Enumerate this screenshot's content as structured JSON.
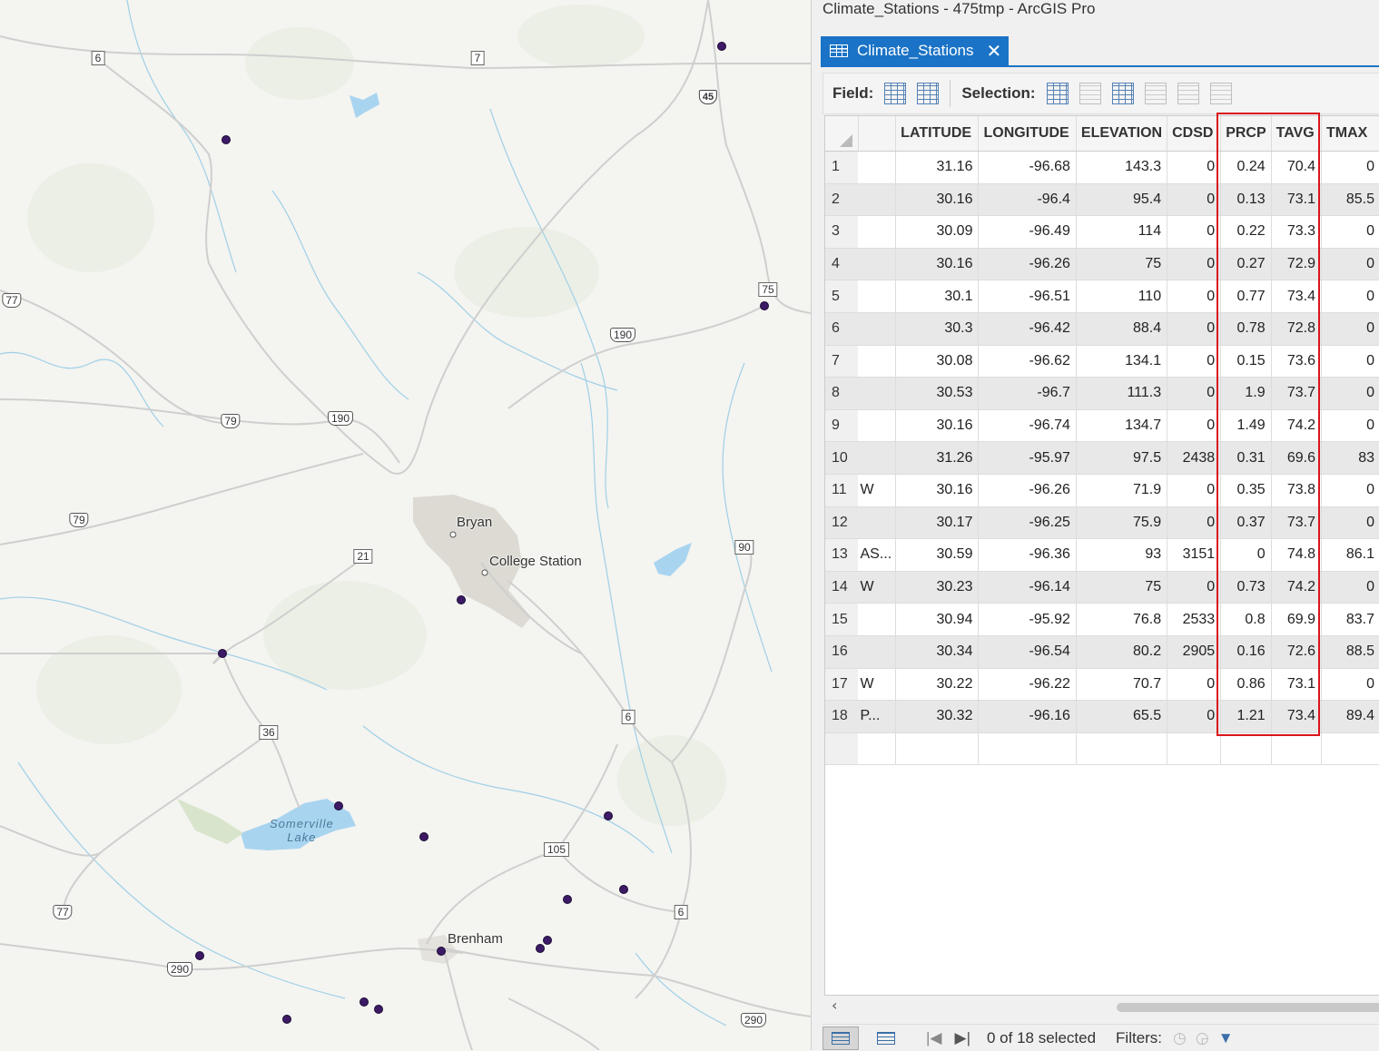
{
  "window": {
    "title": "Climate_Stations - 475tmp - ArcGIS Pro"
  },
  "tab": {
    "label": "Climate_Stations",
    "close_glyph": "✕",
    "icon": "table-icon"
  },
  "toolbar": {
    "field_label": "Field:",
    "selection_label": "Selection:",
    "icons": [
      "add-field-icon",
      "calculate-field-icon",
      "select-by-attributes-icon",
      "zoom-to-selection-icon",
      "switch-selection-icon",
      "clear-selection-icon",
      "delete-selection-icon",
      "copy-selection-icon"
    ]
  },
  "table": {
    "columns": [
      "",
      "LATITUDE",
      "LONGITUDE",
      "ELEVATION",
      "CDSD",
      "PRCP",
      "TAVG",
      "TMAX"
    ],
    "rows": [
      {
        "n": "1",
        "t": "",
        "lat": "31.16",
        "lon": "-96.68",
        "elev": "143.3",
        "cdsd": "0",
        "prcp": "0.24",
        "tavg": "70.4",
        "tmax": "0"
      },
      {
        "n": "2",
        "t": "",
        "lat": "30.16",
        "lon": "-96.4",
        "elev": "95.4",
        "cdsd": "0",
        "prcp": "0.13",
        "tavg": "73.1",
        "tmax": "85.5"
      },
      {
        "n": "3",
        "t": "",
        "lat": "30.09",
        "lon": "-96.49",
        "elev": "114",
        "cdsd": "0",
        "prcp": "0.22",
        "tavg": "73.3",
        "tmax": "0"
      },
      {
        "n": "4",
        "t": "",
        "lat": "30.16",
        "lon": "-96.26",
        "elev": "75",
        "cdsd": "0",
        "prcp": "0.27",
        "tavg": "72.9",
        "tmax": "0"
      },
      {
        "n": "5",
        "t": "",
        "lat": "30.1",
        "lon": "-96.51",
        "elev": "110",
        "cdsd": "0",
        "prcp": "0.77",
        "tavg": "73.4",
        "tmax": "0"
      },
      {
        "n": "6",
        "t": "",
        "lat": "30.3",
        "lon": "-96.42",
        "elev": "88.4",
        "cdsd": "0",
        "prcp": "0.78",
        "tavg": "72.8",
        "tmax": "0"
      },
      {
        "n": "7",
        "t": "",
        "lat": "30.08",
        "lon": "-96.62",
        "elev": "134.1",
        "cdsd": "0",
        "prcp": "0.15",
        "tavg": "73.6",
        "tmax": "0"
      },
      {
        "n": "8",
        "t": "",
        "lat": "30.53",
        "lon": "-96.7",
        "elev": "111.3",
        "cdsd": "0",
        "prcp": "1.9",
        "tavg": "73.7",
        "tmax": "0"
      },
      {
        "n": "9",
        "t": "",
        "lat": "30.16",
        "lon": "-96.74",
        "elev": "134.7",
        "cdsd": "0",
        "prcp": "1.49",
        "tavg": "74.2",
        "tmax": "0"
      },
      {
        "n": "10",
        "t": "",
        "lat": "31.26",
        "lon": "-95.97",
        "elev": "97.5",
        "cdsd": "2438",
        "prcp": "0.31",
        "tavg": "69.6",
        "tmax": "83"
      },
      {
        "n": "11",
        "t": "W",
        "lat": "30.16",
        "lon": "-96.26",
        "elev": "71.9",
        "cdsd": "0",
        "prcp": "0.35",
        "tavg": "73.8",
        "tmax": "0"
      },
      {
        "n": "12",
        "t": "",
        "lat": "30.17",
        "lon": "-96.25",
        "elev": "75.9",
        "cdsd": "0",
        "prcp": "0.37",
        "tavg": "73.7",
        "tmax": "0"
      },
      {
        "n": "13",
        "t": "AS...",
        "lat": "30.59",
        "lon": "-96.36",
        "elev": "93",
        "cdsd": "3151",
        "prcp": "0",
        "tavg": "74.8",
        "tmax": "86.1"
      },
      {
        "n": "14",
        "t": "W",
        "lat": "30.23",
        "lon": "-96.14",
        "elev": "75",
        "cdsd": "0",
        "prcp": "0.73",
        "tavg": "74.2",
        "tmax": "0"
      },
      {
        "n": "15",
        "t": "",
        "lat": "30.94",
        "lon": "-95.92",
        "elev": "76.8",
        "cdsd": "2533",
        "prcp": "0.8",
        "tavg": "69.9",
        "tmax": "83.7"
      },
      {
        "n": "16",
        "t": "",
        "lat": "30.34",
        "lon": "-96.54",
        "elev": "80.2",
        "cdsd": "2905",
        "prcp": "0.16",
        "tavg": "72.6",
        "tmax": "88.5"
      },
      {
        "n": "17",
        "t": "W",
        "lat": "30.22",
        "lon": "-96.22",
        "elev": "70.7",
        "cdsd": "0",
        "prcp": "0.86",
        "tavg": "73.1",
        "tmax": "0"
      },
      {
        "n": "18",
        "t": "P...",
        "lat": "30.32",
        "lon": "-96.16",
        "elev": "65.5",
        "cdsd": "0",
        "prcp": "1.21",
        "tavg": "73.4",
        "tmax": "89.4"
      }
    ]
  },
  "status": {
    "selection_text": "0 of 18 selected",
    "filters_label": "Filters:"
  },
  "map": {
    "cities": [
      "Bryan",
      "College Station",
      "Brenham"
    ],
    "lake": [
      "Somerville",
      "Lake"
    ],
    "shields": [
      "6",
      "7",
      "45",
      "75",
      "190",
      "77",
      "79",
      "190",
      "79",
      "21",
      "90",
      "6",
      "36",
      "105",
      "6",
      "77",
      "290",
      "290"
    ],
    "highlight_color": "#d9151b",
    "station_color": "#3d1a66"
  }
}
